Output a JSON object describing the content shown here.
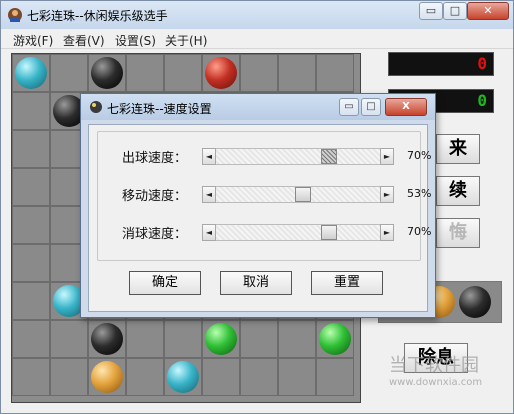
{
  "window": {
    "title": "七彩连珠--休闲娱乐级选手",
    "minimize_label": "▭",
    "maximize_label": "□",
    "close_label": "✕"
  },
  "menu": [
    "游戏(F)",
    "查看(V)",
    "设置(S)",
    "关于(H)"
  ],
  "board": {
    "balls": [
      {
        "row": 0,
        "col": 0,
        "color": "cyan"
      },
      {
        "row": 0,
        "col": 2,
        "color": "black"
      },
      {
        "row": 0,
        "col": 5,
        "color": "red"
      },
      {
        "row": 1,
        "col": 1,
        "color": "black"
      },
      {
        "row": 6,
        "col": 1,
        "color": "cyan"
      },
      {
        "row": 7,
        "col": 2,
        "color": "black"
      },
      {
        "row": 7,
        "col": 5,
        "color": "green"
      },
      {
        "row": 7,
        "col": 8,
        "color": "green"
      },
      {
        "row": 8,
        "col": 2,
        "color": "orange"
      },
      {
        "row": 8,
        "col": 4,
        "color": "cyan"
      }
    ]
  },
  "side": {
    "score_top": "0",
    "score_bottom": "0",
    "btn_restart": "来",
    "btn_continue": "续",
    "btn_disabled": "悔",
    "btn_record": "除息",
    "next_balls": [
      "orange",
      "black"
    ],
    "watermark": "当下软件园",
    "watermark_url": "www.downxia.com"
  },
  "dialog": {
    "title": "七彩连珠--速度设置",
    "min_label": "▭",
    "max_label": "□",
    "close_label": "X",
    "sliders": [
      {
        "label": "出球速度：",
        "value": 0.7,
        "percent": "70%"
      },
      {
        "label": "移动速度：",
        "value": 0.53,
        "percent": "53%"
      },
      {
        "label": "消球速度：",
        "value": 0.7,
        "percent": "70%"
      }
    ],
    "ok_label": "确定",
    "cancel_label": "取消",
    "reset_label": "重置"
  },
  "colors": {
    "score_text": "#e31010",
    "score_text_2": "#1db81d"
  }
}
